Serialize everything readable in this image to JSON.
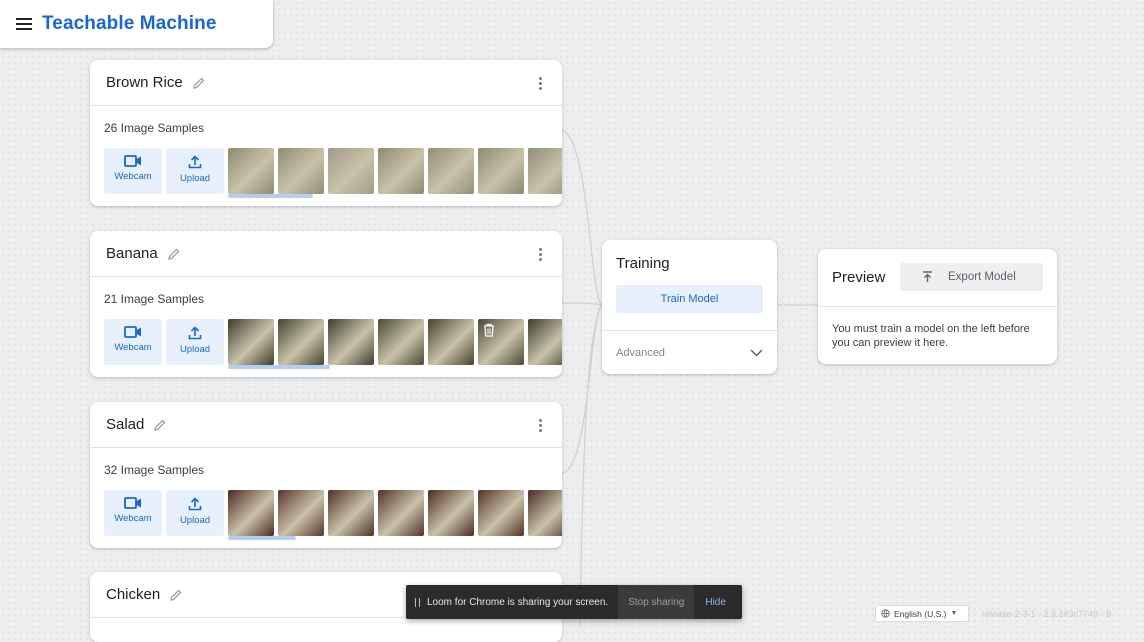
{
  "header": {
    "title": "Teachable Machine"
  },
  "classes": [
    {
      "name": "Brown Rice",
      "samples_label": "26 Image Samples",
      "webcam_label": "Webcam",
      "upload_label": "Upload",
      "thumb_colors": [
        "#8e8a73",
        "#928b76",
        "#a29a8a",
        "#8f8a73",
        "#958f7a",
        "#8c8a73",
        "#938c78"
      ],
      "scroll_progress": 0.25
    },
    {
      "name": "Banana",
      "samples_label": "21 Image Samples",
      "webcam_label": "Webcam",
      "upload_label": "Upload",
      "thumb_colors": [
        "#3e3c2c",
        "#45452f",
        "#3d3d2e",
        "#4b4a33",
        "#48402c",
        "#4a4a37",
        "#3b3b2d"
      ],
      "scroll_progress": 0.3
    },
    {
      "name": "Salad",
      "samples_label": "32 Image Samples",
      "webcam_label": "Webcam",
      "upload_label": "Upload",
      "thumb_colors": [
        "#4c2a22",
        "#58342c",
        "#512f26",
        "#56302a",
        "#4d2a22",
        "#553027",
        "#4a2c24"
      ],
      "scroll_progress": 0.2
    },
    {
      "name": "Chicken"
    }
  ],
  "training": {
    "title": "Training",
    "train_button": "Train Model",
    "advanced_label": "Advanced"
  },
  "preview": {
    "title": "Preview",
    "export_button": "Export Model",
    "message": "You must train a model on the left before you can preview it here."
  },
  "loom": {
    "message": "Loom for Chrome is sharing your screen.",
    "stop_label": "Stop sharing",
    "hide_label": "Hide"
  },
  "footer": {
    "language": "English (U.S.)",
    "release": "release-2-3-1 - 2.3.1#3c7749 - 9"
  },
  "colors": {
    "accent": "#1967d2",
    "button_bg": "#e8f0fe",
    "scrollbar": "#b6cdf2"
  }
}
